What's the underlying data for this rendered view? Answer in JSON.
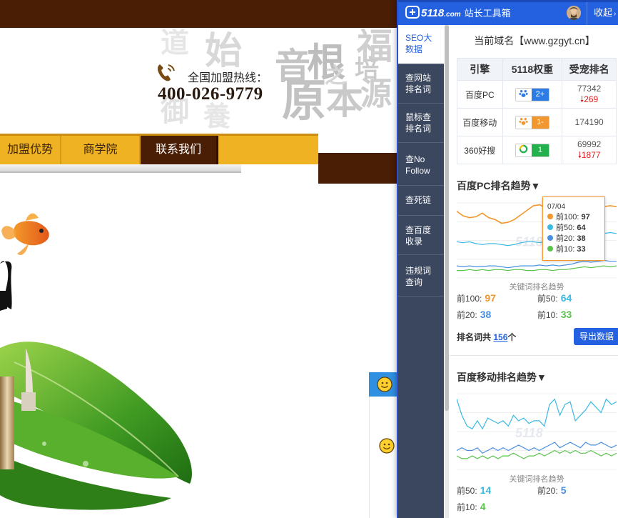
{
  "website": {
    "hotline_label": "全国加盟热线：",
    "hotline_number": "400-026-9779",
    "nav": [
      {
        "label": "加盟优势"
      },
      {
        "label": "商学院"
      },
      {
        "label": "联系我们"
      }
    ]
  },
  "panel": {
    "logo_brand": "5118",
    "logo_com": ".com",
    "logo_title": "站长工具箱",
    "collapse_label": "收起",
    "sidebar": [
      {
        "label": "SEO大数据"
      },
      {
        "label": "查网站排名词"
      },
      {
        "label": "鼠标查排名词"
      },
      {
        "label": "查No Follow"
      },
      {
        "label": "查死链"
      },
      {
        "label": "查百度收录"
      },
      {
        "label": "违规词查询"
      }
    ],
    "domain_text": "当前域名【www.gzgyt.cn】",
    "table": {
      "headers": [
        "引擎",
        "5118权重",
        "受宠排名"
      ],
      "rows": [
        {
          "engine": "百度PC",
          "weight": "2+",
          "rank": "77342",
          "change": "269",
          "weight_color": "#2d7be5"
        },
        {
          "engine": "百度移动",
          "weight": "1-",
          "rank": "174190",
          "change": "",
          "weight_color": "#f2962e"
        },
        {
          "engine": "360好搜",
          "weight": "1",
          "rank": "69992",
          "change": "1877",
          "weight_color": "#22b14c"
        }
      ]
    },
    "pc_trend": {
      "title": "百度PC排名趋势▼",
      "legend_label": "关键词排名趋势",
      "tooltip": {
        "date": "07/04",
        "items": [
          {
            "label": "前100:",
            "value": "97",
            "color": "#f2962e"
          },
          {
            "label": "前50:",
            "value": "64",
            "color": "#3ab9e3"
          },
          {
            "label": "前20:",
            "value": "38",
            "color": "#4a8fe0"
          },
          {
            "label": "前10:",
            "value": "33",
            "color": "#5cc24e"
          }
        ]
      },
      "stats": [
        {
          "label": "前100:",
          "value": "97"
        },
        {
          "label": "前50:",
          "value": "64"
        },
        {
          "label": "前20:",
          "value": "38"
        },
        {
          "label": "前10:",
          "value": "33"
        }
      ],
      "total_label": "排名词共",
      "total_value": "156",
      "total_unit": "个",
      "export_label": "导出数据"
    },
    "mobile_trend": {
      "title": "百度移动排名趋势▼",
      "legend_label": "关键词排名趋势",
      "stats": [
        {
          "label": "前50:",
          "value": "14"
        },
        {
          "label": "前20:",
          "value": "5"
        },
        {
          "label": "前10:",
          "value": "4"
        }
      ]
    }
  },
  "colors": {
    "brand_blue": "#2461e0",
    "site_brown": "#4a1d05",
    "site_gold": "#efb223",
    "sidebar_bg": "#3b475f",
    "top100": "#f2962e",
    "top50": "#3ab9e3",
    "top20": "#4a8fe0",
    "top10": "#5cc24e"
  },
  "chart_data": [
    {
      "type": "line",
      "title": "百度PC排名趋势▼",
      "xlabel": "关键词排名趋势",
      "series": [
        {
          "name": "前100",
          "values": [
            97,
            92,
            90,
            91,
            95,
            90,
            88,
            84,
            85,
            88,
            93,
            98,
            103,
            104,
            100,
            101,
            103,
            100,
            101,
            104,
            103,
            102,
            101,
            102,
            103,
            102
          ]
        },
        {
          "name": "前50",
          "values": [
            64,
            63,
            64,
            62,
            61,
            62,
            62,
            61,
            60,
            61,
            63,
            64,
            64,
            63,
            65,
            64,
            64,
            63,
            65,
            70,
            73,
            74,
            72,
            73,
            74,
            73
          ]
        },
        {
          "name": "前20",
          "values": [
            38,
            37,
            38,
            37,
            37,
            38,
            38,
            37,
            36,
            37,
            38,
            38,
            38,
            39,
            38,
            39,
            38,
            39,
            40,
            42,
            43,
            42,
            43,
            44,
            43,
            43
          ]
        },
        {
          "name": "前10",
          "values": [
            33,
            33,
            34,
            33,
            34,
            33,
            34,
            34,
            33,
            34,
            34,
            33,
            33,
            34,
            34,
            33,
            34,
            34,
            35,
            36,
            37,
            36,
            37,
            38,
            37,
            38
          ]
        }
      ]
    },
    {
      "type": "line",
      "title": "百度移动排名趋势▼",
      "xlabel": "关键词排名趋势",
      "series": [
        {
          "name": "前50",
          "values": [
            26,
            20,
            16,
            15,
            18,
            15,
            19,
            18,
            17,
            18,
            16,
            20,
            18,
            19,
            17,
            18,
            18,
            16,
            24,
            26,
            20,
            24,
            25,
            18,
            20,
            22,
            25,
            23,
            21,
            26,
            24,
            25
          ]
        },
        {
          "name": "前20",
          "values": [
            7,
            8,
            7,
            7,
            8,
            6,
            7,
            8,
            7,
            8,
            7,
            8,
            9,
            8,
            7,
            8,
            7,
            8,
            9,
            10,
            8,
            9,
            10,
            9,
            8,
            10,
            9,
            9,
            10,
            9,
            8,
            9
          ]
        },
        {
          "name": "前10",
          "values": [
            5,
            4,
            4,
            5,
            4,
            5,
            4,
            5,
            4,
            5,
            5,
            6,
            5,
            4,
            5,
            5,
            6,
            5,
            6,
            7,
            6,
            7,
            6,
            7,
            6,
            6,
            7,
            6,
            5,
            6,
            5,
            6
          ]
        }
      ]
    }
  ]
}
